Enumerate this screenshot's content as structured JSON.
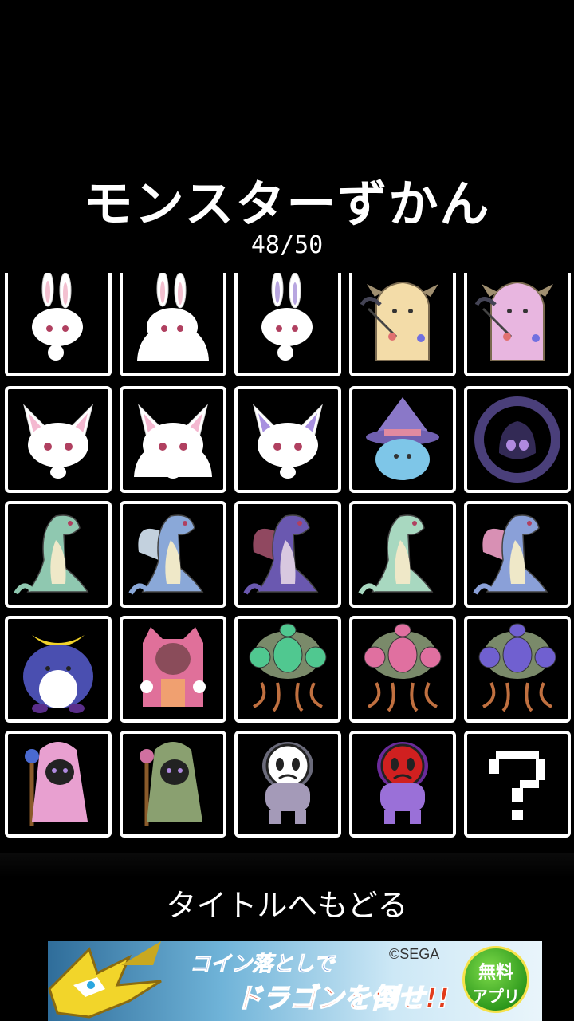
{
  "screen": {
    "title": "モンスターずかん",
    "count": "48/50"
  },
  "grid": {
    "monsters": [
      {
        "name": "white-rabbit-monster-icon",
        "discovered": true
      },
      {
        "name": "white-slime-rabbit-monster-icon",
        "discovered": true
      },
      {
        "name": "lavender-rabbit-monster-icon",
        "discovered": true
      },
      {
        "name": "cream-scythe-monster-icon",
        "discovered": true
      },
      {
        "name": "pink-scythe-monster-icon",
        "discovered": true
      },
      {
        "name": "white-cat-monster-icon",
        "discovered": true
      },
      {
        "name": "white-slime-cat-monster-icon",
        "discovered": true
      },
      {
        "name": "purple-ear-cat-monster-icon",
        "discovered": true
      },
      {
        "name": "witch-hat-ghost-monster-icon",
        "discovered": true
      },
      {
        "name": "dark-flame-ring-monster-icon",
        "discovered": true
      },
      {
        "name": "teal-dragon-monster-icon",
        "discovered": true
      },
      {
        "name": "blue-winged-dragon-monster-icon",
        "discovered": true
      },
      {
        "name": "purple-bat-dragon-monster-icon",
        "discovered": true
      },
      {
        "name": "mint-crawling-dragon-monster-icon",
        "discovered": true
      },
      {
        "name": "pink-winged-dragon-monster-icon",
        "discovered": true
      },
      {
        "name": "crescent-penguin-monster-icon",
        "discovered": true
      },
      {
        "name": "pink-hood-cat-monster-icon",
        "discovered": true
      },
      {
        "name": "green-jellyfish-monster-icon",
        "discovered": true
      },
      {
        "name": "pink-jellyfish-monster-icon",
        "discovered": true
      },
      {
        "name": "purple-jellyfish-monster-icon",
        "discovered": true
      },
      {
        "name": "pink-hooded-mage-monster-icon",
        "discovered": true
      },
      {
        "name": "green-hooded-mage-monster-icon",
        "discovered": true
      },
      {
        "name": "white-mask-golem-monster-icon",
        "discovered": true
      },
      {
        "name": "red-mask-golem-monster-icon",
        "discovered": true
      },
      {
        "name": "unknown-monster-icon",
        "discovered": false
      }
    ]
  },
  "back_button": {
    "label": "タイトルへもどる"
  },
  "banner": {
    "line1": "コイン落としで",
    "line2": "ドラゴンを倒せ!!",
    "copyright": "©SEGA",
    "badge_line1": "無料",
    "badge_line2": "アプリ"
  },
  "colors": {
    "background": "#000000",
    "frame": "#ffffff"
  }
}
